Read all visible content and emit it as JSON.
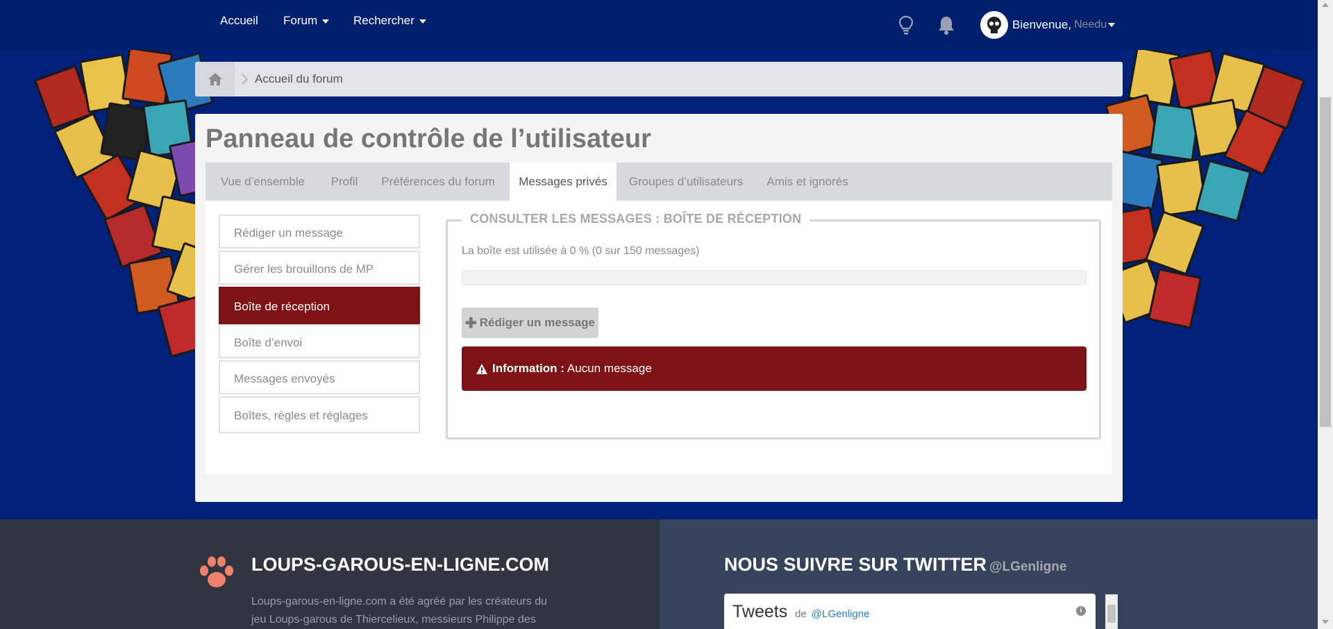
{
  "nav": {
    "home": "Accueil",
    "forum": "Forum",
    "search": "Rechercher",
    "welcome": "Bienvenue,",
    "username": "Needu"
  },
  "breadcrumb": {
    "forum_home": "Accueil du forum"
  },
  "panel": {
    "title": "Panneau de contrôle de l’utilisateur",
    "tabs": [
      {
        "label": "Vue d’ensemble"
      },
      {
        "label": "Profil"
      },
      {
        "label": "Préférences du forum"
      },
      {
        "label": "Messages privés",
        "active": true
      },
      {
        "label": "Groupes d’utilisateurs"
      },
      {
        "label": "Amis et ignorés"
      }
    ],
    "menu": [
      {
        "label": "Rédiger un message"
      },
      {
        "label": "Gérer les brouillons de MP"
      },
      {
        "label": "Boîte de réception",
        "active": true
      },
      {
        "label": "Boîte d’envoi"
      },
      {
        "label": "Messages envoyés"
      },
      {
        "label": "Boîtes, règles et réglages"
      }
    ],
    "inbox": {
      "legend": "CONSULTER LES MESSAGES : BOÎTE DE RÉCEPTION",
      "usage": "La boîte est utilisée à 0 % (0 sur 150 messages)",
      "usage_fraction": 0,
      "compose_label": "Rédiger un message",
      "alert_label": "Information :",
      "alert_text": "Aucun message"
    }
  },
  "footer": {
    "site_title": "LOUPS-GAROUS-EN-LIGNE.COM",
    "site_text": "Loups-garous-en-ligne.com a été agréé par les créateurs du jeu Loups-garous de Thiercelieux, messieurs Philippe des",
    "twitter_title": "NOUS SUIVRE SUR TWITTER",
    "twitter_handle": "@LGenligne",
    "tweets_title": "Tweets",
    "tweets_by": "de",
    "tweets_handle": "@LGenligne"
  },
  "colors": {
    "navbar": "#00206e",
    "accent": "#7d1315",
    "footer_left": "#30353f",
    "footer_right": "#36435a"
  }
}
